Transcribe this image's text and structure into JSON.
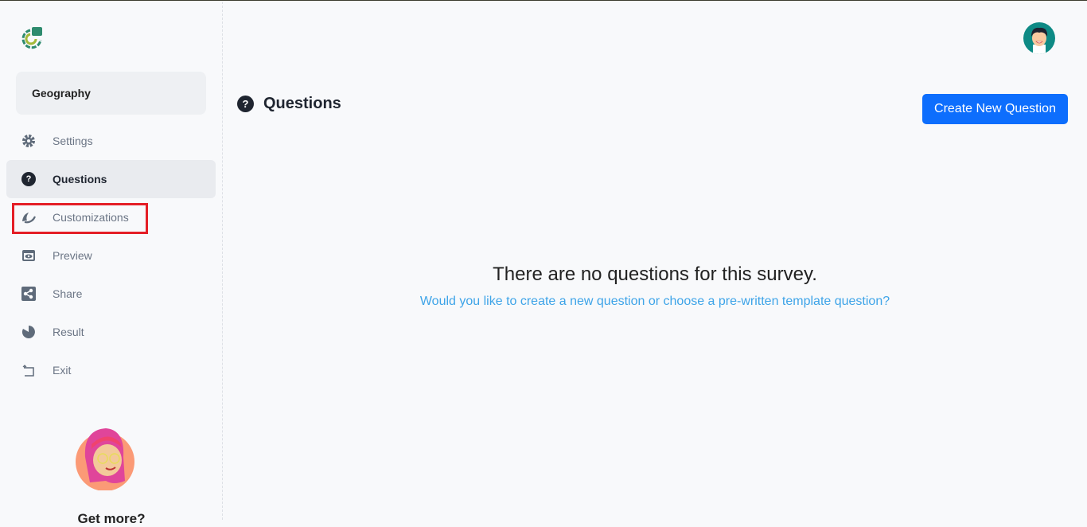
{
  "sidebar": {
    "survey_name": "Geography",
    "items": [
      {
        "label": "Settings",
        "icon": "gear-icon"
      },
      {
        "label": "Questions",
        "icon": "question-circle-icon",
        "active": true
      },
      {
        "label": "Customizations",
        "icon": "brush-icon",
        "highlighted": true
      },
      {
        "label": "Preview",
        "icon": "eye-icon"
      },
      {
        "label": "Share",
        "icon": "share-icon"
      },
      {
        "label": "Result",
        "icon": "pie-chart-icon"
      },
      {
        "label": "Exit",
        "icon": "exit-icon"
      }
    ],
    "promo_title": "Get more?"
  },
  "header": {
    "title": "Questions",
    "create_button": "Create New Question"
  },
  "empty_state": {
    "message": "There are no questions for this survey.",
    "link": "Would you like to create a new question or choose a pre-written template question?"
  },
  "colors": {
    "accent": "#0d6efd",
    "link": "#3ea4e8",
    "highlight": "#e41e26"
  }
}
